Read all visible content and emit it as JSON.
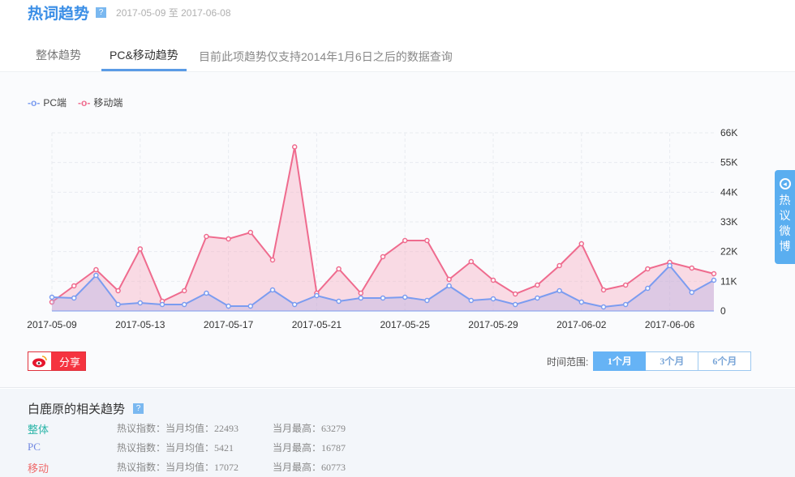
{
  "header": {
    "title": "热词趋势",
    "help": "?",
    "date_from": "2017-05-09",
    "date_sep": "至",
    "date_to": "2017-06-08"
  },
  "tabs": [
    {
      "label": "整体趋势"
    },
    {
      "label": "PC&移动趋势"
    }
  ],
  "tab_note": "目前此项趋势仅支持2014年1月6日之后的数据查询",
  "colors": {
    "pc": "#7b9cf0",
    "mobile": "#ef6b8e",
    "accent": "#5aaef0",
    "share": "#f5333f"
  },
  "chart_data": {
    "type": "area",
    "legend": [
      "PC端",
      "移动端"
    ],
    "legend_marker": "-o-",
    "x": [
      "2017-05-09",
      "2017-05-10",
      "2017-05-11",
      "2017-05-12",
      "2017-05-13",
      "2017-05-14",
      "2017-05-15",
      "2017-05-16",
      "2017-05-17",
      "2017-05-18",
      "2017-05-19",
      "2017-05-20",
      "2017-05-21",
      "2017-05-22",
      "2017-05-23",
      "2017-05-24",
      "2017-05-25",
      "2017-05-26",
      "2017-05-27",
      "2017-05-28",
      "2017-05-29",
      "2017-05-30",
      "2017-05-31",
      "2017-06-01",
      "2017-06-02",
      "2017-06-03",
      "2017-06-04",
      "2017-06-05",
      "2017-06-06",
      "2017-06-07",
      "2017-06-08"
    ],
    "x_ticks": [
      "2017-05-09",
      "2017-05-13",
      "2017-05-17",
      "2017-05-21",
      "2017-05-25",
      "2017-05-29",
      "2017-06-02",
      "2017-06-06"
    ],
    "y_ticks": [
      "0",
      "11K",
      "22K",
      "33K",
      "44K",
      "55K",
      "66K"
    ],
    "ylim": [
      0,
      66000
    ],
    "series": [
      {
        "name": "移动端",
        "values": [
          3300,
          9300,
          15300,
          7500,
          23000,
          3600,
          7500,
          27600,
          26700,
          29100,
          18900,
          60773,
          6600,
          15600,
          6600,
          20100,
          26100,
          26100,
          11700,
          18300,
          11400,
          6300,
          9600,
          16800,
          24900,
          7800,
          9600,
          15600,
          18000,
          15900,
          13800
        ]
      },
      {
        "name": "PC端",
        "values": [
          5100,
          4800,
          13200,
          2400,
          3000,
          2400,
          2400,
          6600,
          1800,
          1800,
          7800,
          2400,
          5700,
          3600,
          4800,
          4800,
          5100,
          3900,
          9300,
          3900,
          4500,
          2400,
          4800,
          7500,
          3300,
          1500,
          2400,
          8400,
          16787,
          6900,
          11400
        ]
      }
    ]
  },
  "share": {
    "label": "分享"
  },
  "range": {
    "label": "时间范围:",
    "options": [
      "1个月",
      "3个月",
      "6个月"
    ],
    "selected": "1个月"
  },
  "related": {
    "title": "白鹿原的相关趋势",
    "help": "?",
    "rows": [
      {
        "name": "整体",
        "avg": "热议指数：当月均值：22493",
        "max": "当月最高：63279",
        "color": "#2bb5a8"
      },
      {
        "name": "PC",
        "avg": "热议指数：当月均值：5421",
        "max": "当月最高：16787",
        "color": "#6f86e0"
      },
      {
        "name": "移动",
        "avg": "热议指数：当月均值：17072",
        "max": "当月最高：60773",
        "color": "#ef6b6b"
      }
    ]
  },
  "side_tab": {
    "label": "热议微博"
  }
}
